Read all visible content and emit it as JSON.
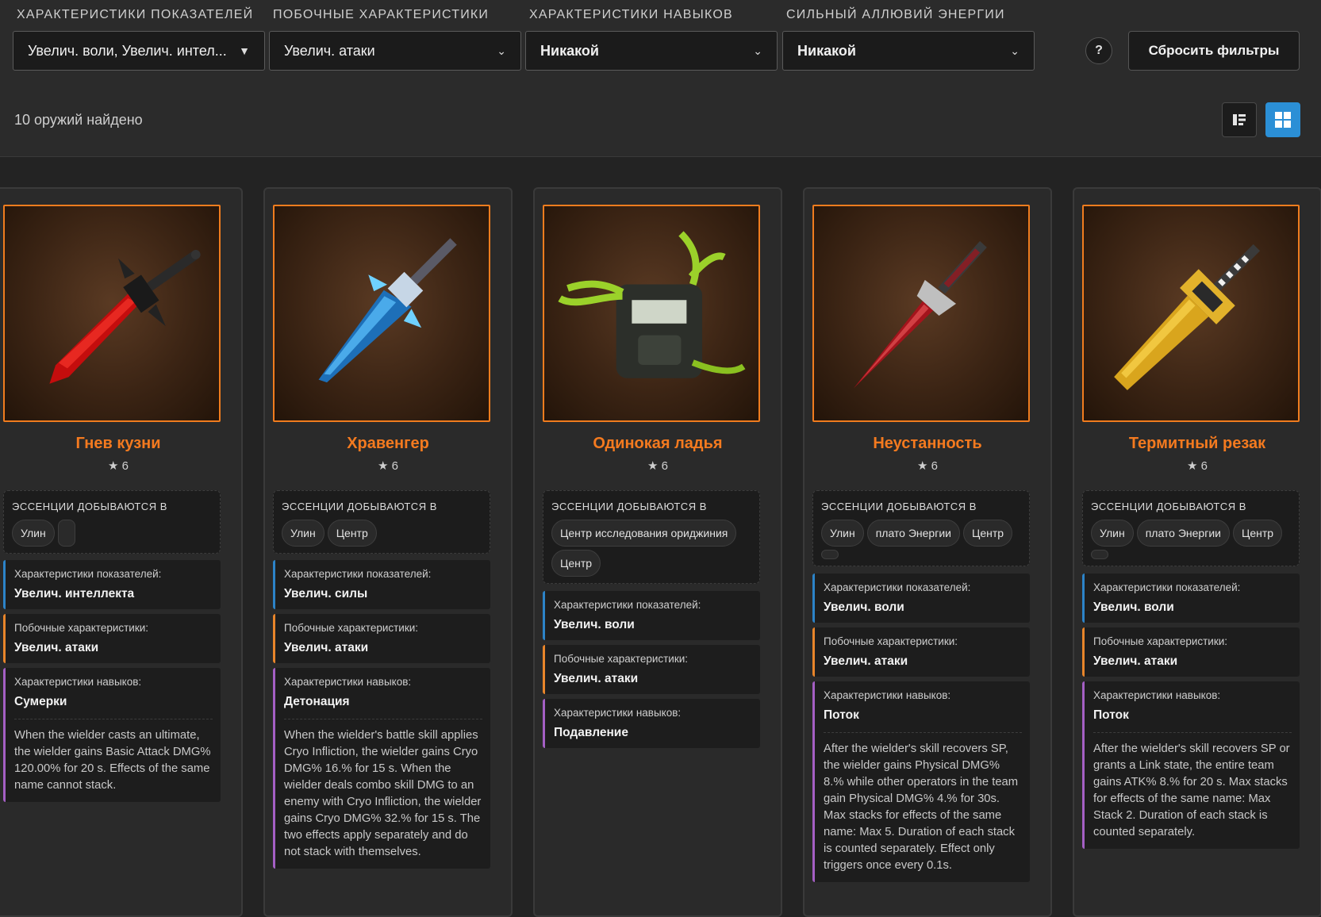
{
  "filters": [
    {
      "label": "ХАРАКТЕРИСТИКИ ПОКАЗАТЕЛЕЙ",
      "value": "Увелич. воли, Увелич. интел...",
      "arrow": "▼",
      "bold": false
    },
    {
      "label": "ПОБОЧНЫЕ ХАРАКТЕРИСТИКИ",
      "value": "Увелич. атаки",
      "arrow": "⌄",
      "bold": false
    },
    {
      "label": "ХАРАКТЕРИСТИКИ НАВЫКОВ",
      "value": "Никакой",
      "arrow": "⌄",
      "bold": true
    },
    {
      "label": "СИЛЬНЫЙ АЛЛЮВИЙ ЭНЕРГИИ",
      "value": "Никакой",
      "arrow": "⌄",
      "bold": true
    }
  ],
  "help_label": "?",
  "reset_label": "Сбросить фильтры",
  "results_count": "10 оружий найдено",
  "view_modes": [
    "list-view-icon",
    "grid-view-icon"
  ],
  "accent_color": "#f47a1f",
  "essence_label": "ЭССЕНЦИИ ДОБЫВАЮТСЯ В",
  "stat_labels": {
    "primary": "Характеристики показателей:",
    "secondary": "Побочные характеристики:",
    "skill": "Характеристики навыков:"
  },
  "weapons": [
    {
      "name": "Гнев кузни",
      "rating": "★ 6",
      "locations": [
        "Улин",
        ""
      ],
      "primary": "Увелич. интеллекта",
      "secondary": "Увелич. атаки",
      "skill": "Сумерки",
      "skill_desc": "When the wielder casts an ultimate, the wielder gains Basic Attack DMG% 120.00% for 20 s. Effects of the same name cannot stack."
    },
    {
      "name": "Хравенгер",
      "rating": "★ 6",
      "locations": [
        "Улин",
        "Центр"
      ],
      "primary": "Увелич. силы",
      "secondary": "Увелич. атаки",
      "skill": "Детонация",
      "skill_desc": "When the wielder's battle skill applies Cryo Infliction, the wielder gains Cryo DMG% 16.% for 15 s. When the wielder deals combo skill DMG to an enemy with Cryo Infliction, the wielder gains Cryo DMG% 32.% for 15 s. The two effects apply separately and do not stack with themselves."
    },
    {
      "name": "Одинокая ладья",
      "rating": "★ 6",
      "locations": [
        "Центр исследования ориджиния",
        "Центр"
      ],
      "primary": "Увелич. воли",
      "secondary": "Увелич. атаки",
      "skill": "Подавление",
      "skill_desc": ""
    },
    {
      "name": "Неустанность",
      "rating": "★ 6",
      "locations": [
        "Улин",
        "плато Энергии",
        "Центр",
        ""
      ],
      "primary": "Увелич. воли",
      "secondary": "Увелич. атаки",
      "skill": "Поток",
      "skill_desc": "After the wielder's skill recovers SP, the wielder gains Physical DMG% 8.% while other operators in the team gain Physical DMG% 4.% for 30s. Max stacks for effects of the same name: Max 5. Duration of each stack is counted separately. Effect only triggers once every 0.1s."
    },
    {
      "name": "Термитный резак",
      "rating": "★ 6",
      "locations": [
        "Улин",
        "плато Энергии",
        "Центр",
        ""
      ],
      "primary": "Увелич. воли",
      "secondary": "Увелич. атаки",
      "skill": "Поток",
      "skill_desc": "After the wielder's skill recovers SP or grants a Link state, the entire team gains ATK% 8.% for 20 s. Max stacks for effects of the same name: Max Stack 2. Duration of each stack is counted separately."
    }
  ]
}
